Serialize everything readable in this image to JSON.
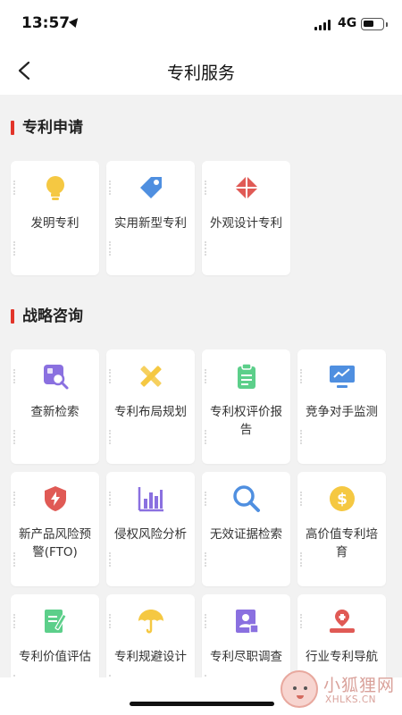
{
  "status_bar": {
    "time": "13:57",
    "network": "4G",
    "battery_level": 0.6
  },
  "nav": {
    "title": "专利服务",
    "back_icon": "chevron-left-icon"
  },
  "sections": [
    {
      "title": "专利申请",
      "cards": [
        {
          "label": "发明专利",
          "icon": "lightbulb-icon",
          "color": "#f5c842"
        },
        {
          "label": "实用新型专利",
          "icon": "tag-icon",
          "color": "#4f8fe0"
        },
        {
          "label": "外观设计专利",
          "icon": "diamond-icon",
          "color": "#e05a55"
        }
      ]
    },
    {
      "title": "战略咨询",
      "cards": [
        {
          "label": "查新检索",
          "icon": "search-window-icon",
          "color": "#8a70e0"
        },
        {
          "label": "专利布局规划",
          "icon": "ruler-pencil-icon",
          "color": "#f5c842"
        },
        {
          "label": "专利权评价报告",
          "icon": "clipboard-icon",
          "color": "#5ccf8a"
        },
        {
          "label": "竞争对手监测",
          "icon": "monitor-chart-icon",
          "color": "#4f8fe0"
        },
        {
          "label": "新产品风险预警(FTO)",
          "icon": "shield-bolt-icon",
          "color": "#e05a55"
        },
        {
          "label": "侵权风险分析",
          "icon": "bar-chart-icon",
          "color": "#8a70e0"
        },
        {
          "label": "无效证据检索",
          "icon": "magnifier-icon",
          "color": "#4f8fe0"
        },
        {
          "label": "高价值专利培育",
          "icon": "dollar-coin-icon",
          "color": "#f5c842"
        },
        {
          "label": "专利价值评估",
          "icon": "document-pen-icon",
          "color": "#5ccf8a"
        },
        {
          "label": "专利规避设计",
          "icon": "umbrella-icon",
          "color": "#f5c842"
        },
        {
          "label": "专利尽职调查",
          "icon": "id-card-icon",
          "color": "#8a70e0"
        },
        {
          "label": "行业专利导航",
          "icon": "map-pin-icon",
          "color": "#e05a55"
        }
      ]
    }
  ],
  "watermark": {
    "text": "小狐狸网",
    "sub": "XHLKS.CN"
  }
}
